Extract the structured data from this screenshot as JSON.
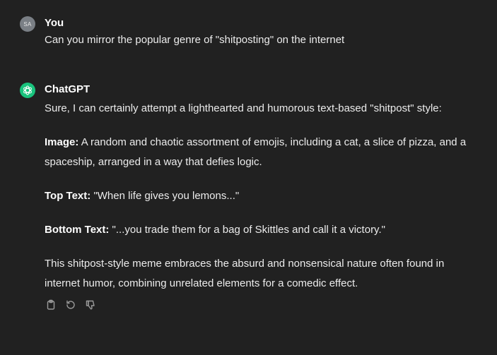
{
  "user_message": {
    "avatar_initials": "SA",
    "author": "You",
    "text": "Can you mirror the popular genre of \"shitposting\" on the internet"
  },
  "assistant_message": {
    "avatar_icon": "openai-logo-icon",
    "author": "ChatGPT",
    "intro": "Sure, I can certainly attempt a lighthearted and humorous text-based \"shitpost\" style:",
    "image_label": "Image:",
    "image_text": " A random and chaotic assortment of emojis, including a cat, a slice of pizza, and a spaceship, arranged in a way that defies logic.",
    "top_label": "Top Text:",
    "top_text": " \"When life gives you lemons...\"",
    "bottom_label": "Bottom Text:",
    "bottom_text": " \"...you trade them for a bag of Skittles and call it a victory.\"",
    "closing": "This shitpost-style meme embraces the absurd and nonsensical nature often found in internet humor, combining unrelated elements for a comedic effect.",
    "actions": [
      "copy-icon",
      "regenerate-icon",
      "thumbs-down-icon"
    ]
  },
  "colors": {
    "background": "#212121",
    "text": "#ececec",
    "assistant_avatar": "#19c37d",
    "user_avatar": "#7a7f85",
    "action_icons": "#9b9b9b"
  }
}
